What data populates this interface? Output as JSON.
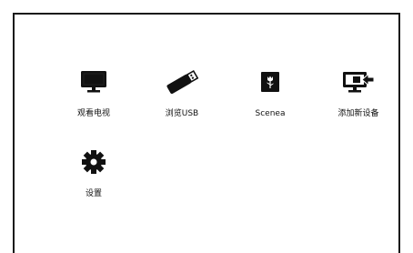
{
  "menu": {
    "items": [
      {
        "label": "观看电视",
        "icon": "tv-icon"
      },
      {
        "label": "浏览USB",
        "icon": "usb-drive-icon"
      },
      {
        "label": "Scenea",
        "icon": "scenea-flower-icon"
      },
      {
        "label": "添加新设备",
        "icon": "add-device-icon"
      },
      {
        "label": "设置",
        "icon": "gear-icon"
      }
    ]
  },
  "colors": {
    "background": "#ffffff",
    "icon": "#111111",
    "frame": "#1a1a1a"
  }
}
